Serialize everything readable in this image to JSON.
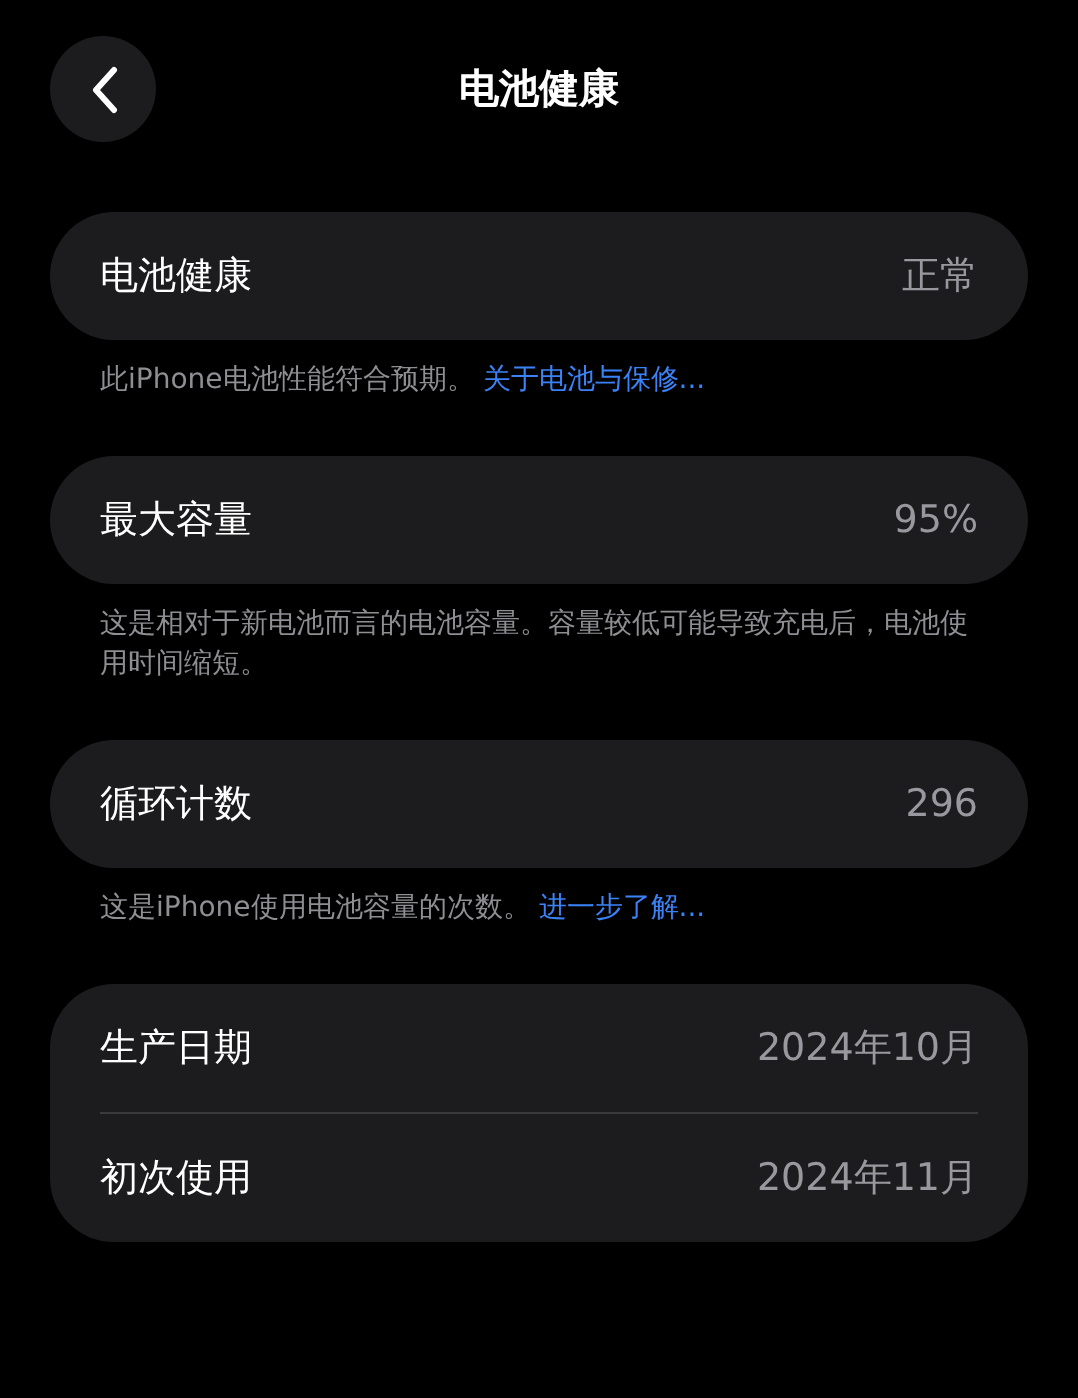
{
  "header": {
    "title": "电池健康"
  },
  "sections": [
    {
      "rows": [
        {
          "label": "电池健康",
          "value": "正常"
        }
      ],
      "footer": {
        "text": "此iPhone电池性能符合预期。",
        "link": "关于电池与保修..."
      }
    },
    {
      "rows": [
        {
          "label": "最大容量",
          "value": "95%"
        }
      ],
      "footer": {
        "text": "这是相对于新电池而言的电池容量。容量较低可能导致充电后，电池使用时间缩短。"
      }
    },
    {
      "rows": [
        {
          "label": "循环计数",
          "value": "296"
        }
      ],
      "footer": {
        "text": "这是iPhone使用电池容量的次数。",
        "link": "进一步了解..."
      }
    },
    {
      "rows": [
        {
          "label": "生产日期",
          "value": "2024年10月"
        },
        {
          "label": "初次使用",
          "value": "2024年11月"
        }
      ]
    }
  ]
}
